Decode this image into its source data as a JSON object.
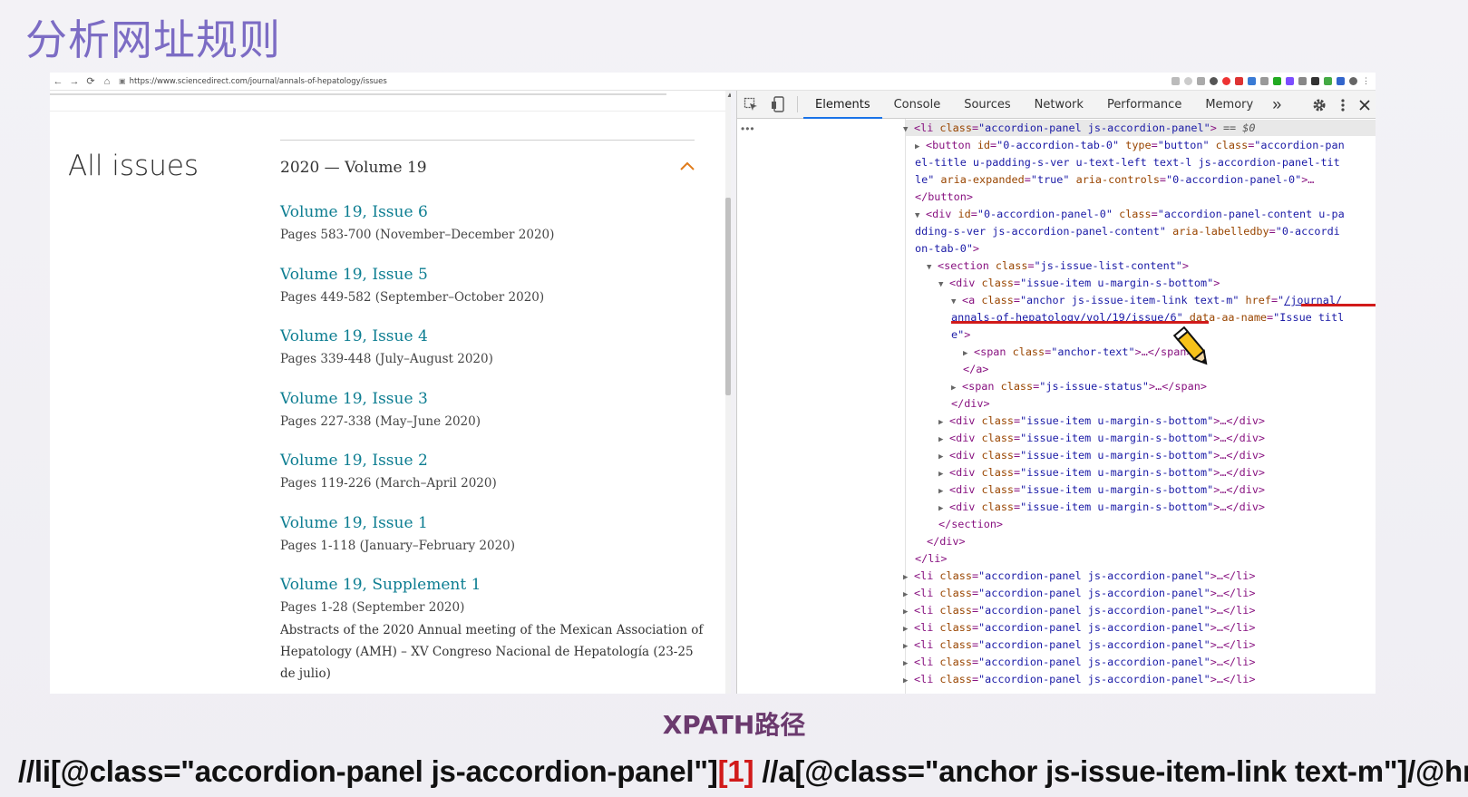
{
  "slide": {
    "title": "分析网址规则",
    "xpath_label": "XPATH路径",
    "xpath_prefix": "//li[@class=\"accordion-panel js-accordion-panel\"]",
    "xpath_index": "[1]",
    "xpath_suffix": " //a[@class=\"anchor js-issue-item-link text-m\"]/@href"
  },
  "browser": {
    "url": "https://www.sciencedirect.com/journal/annals-of-hepatology/issues",
    "back_icon": "←",
    "forward_icon": "→",
    "reload_icon": "⟳",
    "home_icon": "⌂"
  },
  "page": {
    "heading": "All issues",
    "volume_header": "2020 — Volume 19",
    "issues": [
      {
        "title": "Volume 19, Issue 6",
        "pages": "Pages 583-700 (November–December 2020)"
      },
      {
        "title": "Volume 19, Issue 5",
        "pages": "Pages 449-582 (September–October 2020)"
      },
      {
        "title": "Volume 19, Issue 4",
        "pages": "Pages 339-448 (July–August 2020)"
      },
      {
        "title": "Volume 19, Issue 3",
        "pages": "Pages 227-338 (May–June 2020)"
      },
      {
        "title": "Volume 19, Issue 2",
        "pages": "Pages 119-226 (March–April 2020)"
      },
      {
        "title": "Volume 19, Issue 1",
        "pages": "Pages 1-118 (January–February 2020)"
      }
    ],
    "supplement": {
      "title": "Volume 19, Supplement 1",
      "pages": "Pages 1-28 (September 2020)",
      "desc": "Abstracts of the 2020 Annual meeting of the Mexican Association of Hepatology (AMH) – XV Congreso Nacional de Hepatología (23-25 de julio)"
    }
  },
  "devtools": {
    "tabs": [
      "Elements",
      "Console",
      "Sources",
      "Network",
      "Performance",
      "Memory"
    ],
    "active_tab": "Elements",
    "more_tabs": "»",
    "dots": "•••",
    "lines": {
      "l1_tag": "<li ",
      "l1_an": "class",
      "l1_av": "\"accordion-panel js-accordion-panel\"",
      "l1_end": ">",
      "l1_eq": " == $0",
      "l2a": "<button ",
      "l2b": "id",
      "l2c": "\"0-accordion-tab-0\"",
      "l2d": " type",
      "l2e": "\"button\"",
      "l2f": " class",
      "l2g": "\"accordion-pan",
      "l3": "el-title u-padding-s-ver u-text-left text-l js-accordion-panel-tit",
      "l4a": "le\"",
      "l4b": " aria-expanded",
      "l4c": "\"true\"",
      "l4d": " aria-controls",
      "l4e": "\"0-accordion-panel-0\"",
      "l4f": ">…",
      "l5": "</button>",
      "l6a": "<div ",
      "l6b": "id",
      "l6c": "\"0-accordion-panel-0\"",
      "l6d": " class",
      "l6e": "\"accordion-panel-content u-pa",
      "l7a": "dding-s-ver js-accordion-panel-content\"",
      "l7b": " aria-labelledby",
      "l7c": "\"0-accordi",
      "l8a": "on-tab-0\"",
      "l8b": ">",
      "l9a": "<section ",
      "l9b": "class",
      "l9c": "\"js-issue-list-content\"",
      "l9d": ">",
      "l10a": "<div ",
      "l10b": "class",
      "l10c": "\"issue-item u-margin-s-bottom\"",
      "l10d": ">",
      "l11a": "<a ",
      "l11b": "class",
      "l11c": "\"anchor js-issue-item-link text-m\"",
      "l11d": " href",
      "l11e": "\"",
      "l11f": "/journal/",
      "l12a": "annals-of-hepatology/vol/19/issue/6",
      "l12b": "\"",
      "l12c": " data-aa-name",
      "l12d": "\"Issue titl",
      "l13a": "e\"",
      "l13b": ">",
      "l14a": "<span ",
      "l14b": "class",
      "l14c": "\"anchor-text\"",
      "l14d": ">…</span>",
      "l15": "</a>",
      "l16a": "<span ",
      "l16b": "class",
      "l16c": "\"js-issue-status\"",
      "l16d": ">…</span>",
      "l17": "</div>",
      "item_div_open": "<div ",
      "item_div_an": "class",
      "item_div_av": "\"issue-item u-margin-s-bottom\"",
      "item_div_end": ">…</div>",
      "l24": "</section>",
      "l25": "</div>",
      "l26": "</li>",
      "li_open": "<li ",
      "li_an": "class",
      "li_av": "\"accordion-panel js-accordion-panel\"",
      "li_end": ">…</li>"
    }
  },
  "colors": {
    "title": "#7c6cc4",
    "link": "#0c7d91",
    "xpath_label": "#6b3a6e",
    "highlight_red": "#d11a1a"
  }
}
